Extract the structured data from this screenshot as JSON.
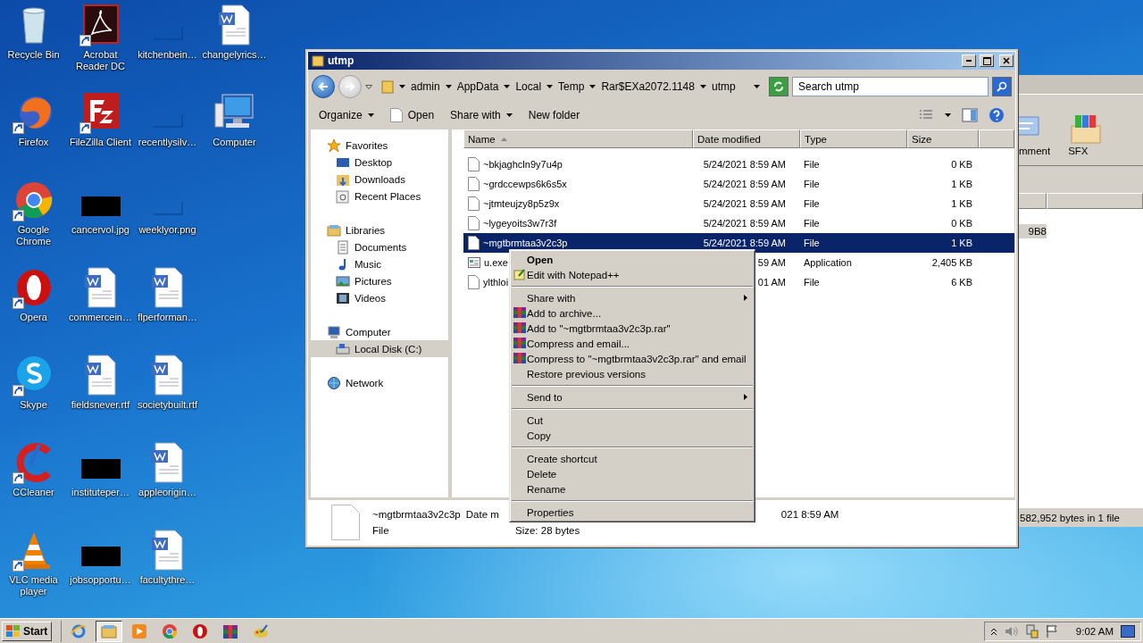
{
  "desktop": {
    "icons": [
      {
        "label": "Recycle Bin",
        "kind": "recycle",
        "shortcut": false
      },
      {
        "label": "Firefox",
        "kind": "firefox",
        "shortcut": true
      },
      {
        "label": "Google Chrome",
        "kind": "chrome",
        "shortcut": true
      },
      {
        "label": "Opera",
        "kind": "opera",
        "shortcut": true
      },
      {
        "label": "Skype",
        "kind": "skype",
        "shortcut": true
      },
      {
        "label": "CCleaner",
        "kind": "ccleaner",
        "shortcut": true
      },
      {
        "label": "VLC media player",
        "kind": "vlc",
        "shortcut": true
      },
      {
        "label": "Acrobat Reader DC",
        "kind": "acrobat",
        "shortcut": true
      },
      {
        "label": "FileZilla Client",
        "kind": "filezilla",
        "shortcut": true
      },
      {
        "label": "cancervol.jpg",
        "kind": "black",
        "shortcut": false
      },
      {
        "label": "commercein…",
        "kind": "word",
        "shortcut": false
      },
      {
        "label": "fieldsnever.rtf",
        "kind": "word",
        "shortcut": false
      },
      {
        "label": "instituteper…",
        "kind": "black",
        "shortcut": false
      },
      {
        "label": "jobsopportu…",
        "kind": "black",
        "shortcut": false
      },
      {
        "label": "kitchenbein…",
        "kind": "thumb",
        "shortcut": false
      },
      {
        "label": "recentlysilv…",
        "kind": "thumb",
        "shortcut": false
      },
      {
        "label": "weeklyor.png",
        "kind": "thumb",
        "shortcut": false
      },
      {
        "label": "flperforman…",
        "kind": "word",
        "shortcut": false
      },
      {
        "label": "societybuilt.rtf",
        "kind": "word",
        "shortcut": false
      },
      {
        "label": "appleorigin…",
        "kind": "word",
        "shortcut": false
      },
      {
        "label": "facultythre…",
        "kind": "word",
        "shortcut": false
      },
      {
        "label": "changelyrics…",
        "kind": "word",
        "shortcut": false
      },
      {
        "label": "Computer",
        "kind": "computer",
        "shortcut": false
      }
    ]
  },
  "background_window": {
    "buttons": [
      {
        "label": "mment",
        "kind": "comment"
      },
      {
        "label": "SFX",
        "kind": "sfx"
      }
    ],
    "selected_cell": "9B8",
    "status": "582,952 bytes in 1 file"
  },
  "explorer": {
    "title": "utmp",
    "breadcrumbs": [
      "admin",
      "AppData",
      "Local",
      "Temp",
      "Rar$EXa2072.1148",
      "utmp"
    ],
    "search": {
      "placeholder": "Search utmp"
    },
    "toolbar": [
      {
        "label": "Organize",
        "kind": "menu"
      },
      {
        "label": "Open",
        "kind": "file"
      },
      {
        "label": "Share with",
        "kind": "menu"
      },
      {
        "label": "New folder",
        "kind": "plain"
      }
    ],
    "nav": [
      {
        "label": "Favorites",
        "kind": "star",
        "selected": false,
        "children": [
          {
            "label": "Desktop",
            "kind": "desktop",
            "selected": false
          },
          {
            "label": "Downloads",
            "kind": "downloads",
            "selected": false
          },
          {
            "label": "Recent Places",
            "kind": "recent",
            "selected": false
          }
        ]
      },
      {
        "label": "Libraries",
        "kind": "libraries",
        "selected": false,
        "children": [
          {
            "label": "Documents",
            "kind": "documents",
            "selected": false
          },
          {
            "label": "Music",
            "kind": "music",
            "selected": false
          },
          {
            "label": "Pictures",
            "kind": "pictures",
            "selected": false
          },
          {
            "label": "Videos",
            "kind": "videos",
            "selected": false
          }
        ]
      },
      {
        "label": "Computer",
        "kind": "computer",
        "selected": false,
        "children": [
          {
            "label": "Local Disk (C:)",
            "kind": "disk",
            "selected": true
          }
        ]
      },
      {
        "label": "Network",
        "kind": "network",
        "selected": false
      }
    ],
    "columns": [
      "Name",
      "Date modified",
      "Type",
      "Size"
    ],
    "rows": [
      {
        "name": "~bkjaghcln9y7u4p",
        "date": "5/24/2021 8:59 AM",
        "type": "File",
        "size": "0 KB",
        "kind": "file",
        "selected": false
      },
      {
        "name": "~grdccewps6k6s5x",
        "date": "5/24/2021 8:59 AM",
        "type": "File",
        "size": "1 KB",
        "kind": "file",
        "selected": false
      },
      {
        "name": "~jtmteujzy8p5z9x",
        "date": "5/24/2021 8:59 AM",
        "type": "File",
        "size": "1 KB",
        "kind": "file",
        "selected": false
      },
      {
        "name": "~lygeyoits3w7r3f",
        "date": "5/24/2021 8:59 AM",
        "type": "File",
        "size": "0 KB",
        "kind": "file",
        "selected": false
      },
      {
        "name": "~mgtbrmtaa3v2c3p",
        "date": "5/24/2021 8:59 AM",
        "type": "File",
        "size": "1 KB",
        "kind": "file",
        "selected": true
      },
      {
        "name": "u.exe",
        "date": "59 AM",
        "type": "Application",
        "size": "2,405 KB",
        "kind": "app",
        "selected": false
      },
      {
        "name": "ylthloi",
        "date": "01 AM",
        "type": "File",
        "size": "6 KB",
        "kind": "file",
        "selected": false
      }
    ],
    "details": {
      "name": "~mgtbrmtaa3v2c3p",
      "date_label": "Date m",
      "date_value": "021 8:59 AM",
      "type": "File",
      "size": "Size: 28 bytes"
    }
  },
  "context_menu": {
    "items": [
      {
        "kind": "item",
        "label": "Open",
        "default": true,
        "submenu": false
      },
      {
        "kind": "notepad",
        "label": "Edit with Notepad++",
        "default": false,
        "submenu": false
      },
      {
        "kind": "separator"
      },
      {
        "kind": "item",
        "label": "Share with",
        "default": false,
        "submenu": true
      },
      {
        "kind": "winrar",
        "label": "Add to archive...",
        "default": false,
        "submenu": false
      },
      {
        "kind": "winrar",
        "label": "Add to \"~mgtbrmtaa3v2c3p.rar\"",
        "default": false,
        "submenu": false
      },
      {
        "kind": "winrar",
        "label": "Compress and email...",
        "default": false,
        "submenu": false
      },
      {
        "kind": "winrar",
        "label": "Compress to \"~mgtbrmtaa3v2c3p.rar\" and email",
        "default": false,
        "submenu": false
      },
      {
        "kind": "item",
        "label": "Restore previous versions",
        "default": false,
        "submenu": false
      },
      {
        "kind": "separator"
      },
      {
        "kind": "item",
        "label": "Send to",
        "default": false,
        "submenu": true
      },
      {
        "kind": "separator"
      },
      {
        "kind": "item",
        "label": "Cut",
        "default": false,
        "submenu": false
      },
      {
        "kind": "item",
        "label": "Copy",
        "default": false,
        "submenu": false
      },
      {
        "kind": "separator"
      },
      {
        "kind": "item",
        "label": "Create shortcut",
        "default": false,
        "submenu": false
      },
      {
        "kind": "item",
        "label": "Delete",
        "default": false,
        "submenu": false
      },
      {
        "kind": "item",
        "label": "Rename",
        "default": false,
        "submenu": false
      },
      {
        "kind": "separator"
      },
      {
        "kind": "item",
        "label": "Properties",
        "default": false,
        "submenu": false
      }
    ]
  },
  "taskbar": {
    "start": "Start",
    "apps": [
      {
        "kind": "ie",
        "active": false
      },
      {
        "kind": "explorer",
        "active": true
      },
      {
        "kind": "media",
        "active": false
      },
      {
        "kind": "chrome",
        "active": false
      },
      {
        "kind": "opera",
        "active": false
      },
      {
        "kind": "winrar",
        "active": false
      },
      {
        "kind": "paint",
        "active": false
      }
    ],
    "clock": "9:02 AM"
  }
}
